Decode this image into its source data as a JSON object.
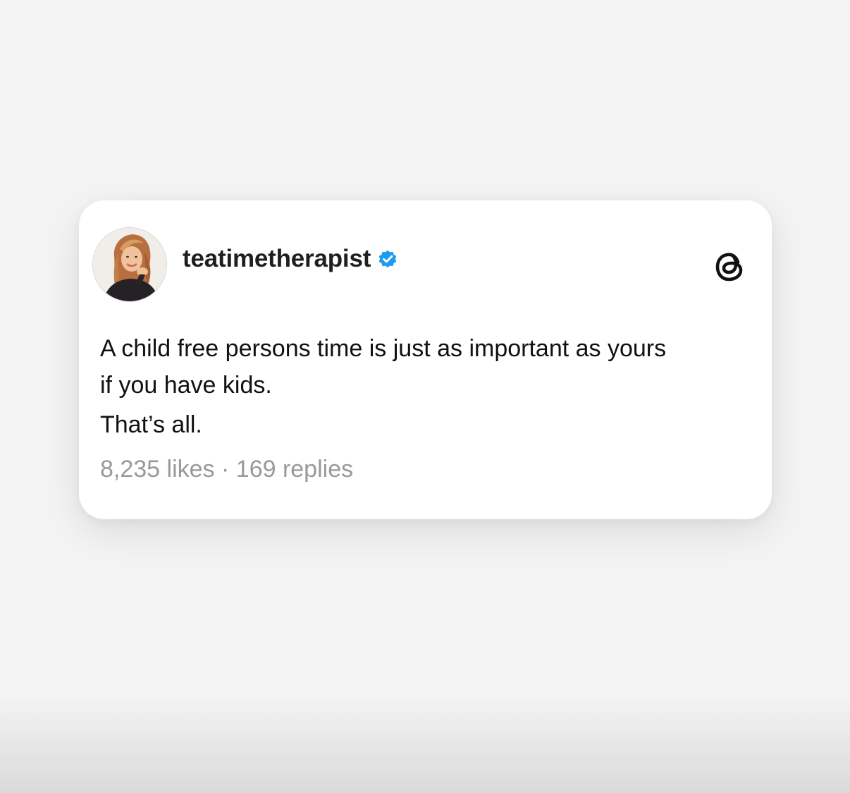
{
  "post": {
    "username": "teatimetherapist",
    "verified_icon": "verified-badge-icon",
    "verified_color": "#1d9bf0",
    "platform_icon": "threads-logo-icon",
    "avatar": "profile-photo-woman-long-hair",
    "text_lines": [
      "A child free persons time is just as important as yours",
      "if you have kids.",
      "That’s all."
    ],
    "likes": "8,235 likes",
    "separator": "·",
    "replies": "169 replies"
  },
  "colors": {
    "background": "#f4f4f4",
    "card": "#ffffff",
    "text": "#111111",
    "muted": "#999999"
  }
}
